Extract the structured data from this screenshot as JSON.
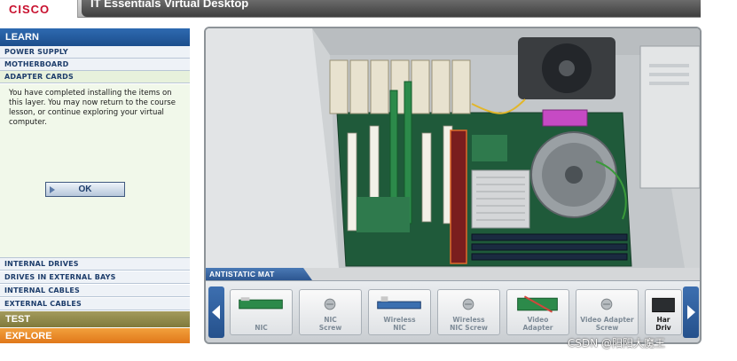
{
  "header": {
    "logo": "CISCO",
    "title": "IT Essentials Virtual Desktop"
  },
  "sidebar": {
    "learn_label": "LEARN",
    "items_top": [
      "POWER SUPPLY",
      "MOTHERBOARD",
      "ADAPTER CARDS"
    ],
    "message": "You have completed installing the items on this layer. You may now return to the course lesson, or continue exploring your virtual computer.",
    "ok_label": "OK",
    "items_bottom": [
      "INTERNAL DRIVES",
      "DRIVES IN EXTERNAL BAYS",
      "INTERNAL CABLES",
      "EXTERNAL CABLES"
    ],
    "test_label": "TEST",
    "explore_label": "EXPLORE"
  },
  "tray": {
    "label": "ANTISTATIC MAT",
    "items": [
      {
        "line1": "NIC",
        "line2": ""
      },
      {
        "line1": "NIC",
        "line2": "Screw"
      },
      {
        "line1": "Wireless",
        "line2": "NIC"
      },
      {
        "line1": "Wireless",
        "line2": "NIC Screw"
      },
      {
        "line1": "Video",
        "line2": "Adapter"
      },
      {
        "line1": "Video Adapter",
        "line2": "Screw"
      },
      {
        "line1": "Har",
        "line2": "Driv"
      }
    ]
  },
  "watermark": "CSDN @阳阳大魔王",
  "colors": {
    "accent_blue": "#2e6ab1",
    "test": "#8f8a4a",
    "explore": "#e88a26",
    "logo_red": "#c8102e"
  }
}
